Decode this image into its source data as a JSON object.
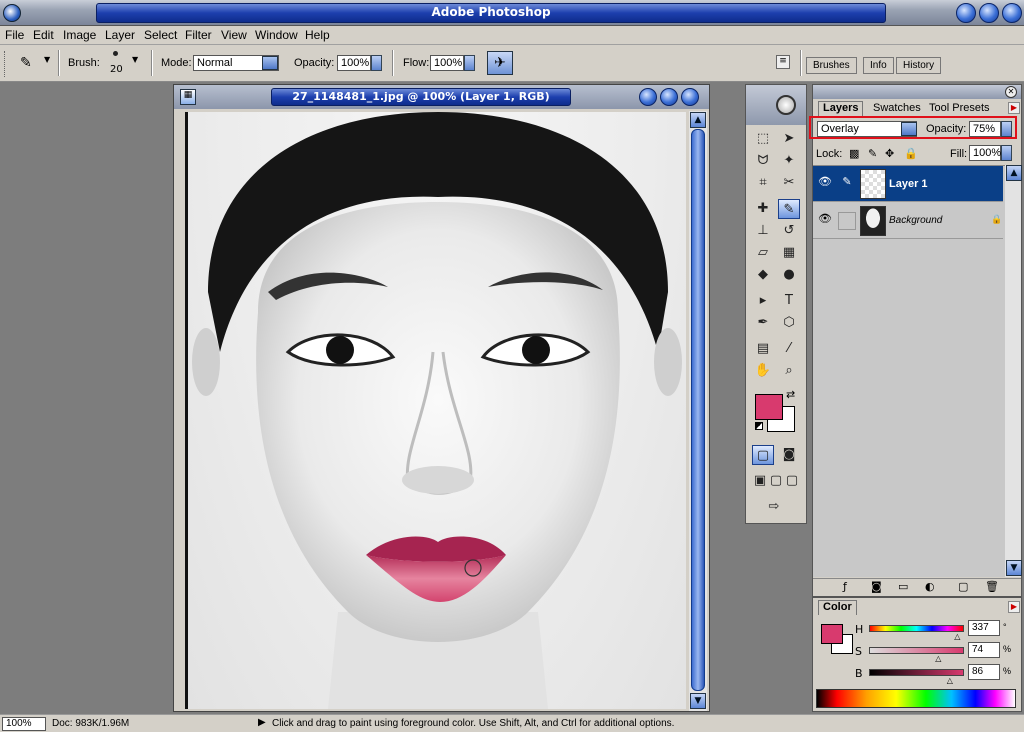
{
  "window": {
    "title": "Adobe Photoshop"
  },
  "menu": [
    "File",
    "Edit",
    "Image",
    "Layer",
    "Select",
    "Filter",
    "View",
    "Window",
    "Help"
  ],
  "options_bar": {
    "brush_label": "Brush:",
    "brush_size": "20",
    "mode_label": "Mode:",
    "mode_value": "Normal",
    "opacity_label": "Opacity:",
    "opacity_value": "100%",
    "flow_label": "Flow:",
    "flow_value": "100%"
  },
  "palette_well_tabs": [
    "Brushes",
    "Info",
    "History"
  ],
  "document": {
    "title": "27_1148481_1.jpg @ 100% (Layer 1, RGB)"
  },
  "layers_panel": {
    "tabs": [
      "Layers",
      "Swatches",
      "Tool Presets"
    ],
    "blend_mode": "Overlay",
    "opacity_label": "Opacity:",
    "opacity_value": "75%",
    "lock_label": "Lock:",
    "fill_label": "Fill:",
    "fill_value": "100%",
    "layers": [
      {
        "name": "Layer 1",
        "selected": true
      },
      {
        "name": "Background",
        "selected": false
      }
    ]
  },
  "color_panel": {
    "tab": "Color",
    "foreground_color": "#d83a6e",
    "background_color": "#ffffff",
    "channels": [
      {
        "label": "H",
        "value": "337",
        "unit": "°",
        "level": 0.94
      },
      {
        "label": "S",
        "value": "74",
        "unit": "%",
        "level": 0.74
      },
      {
        "label": "B",
        "value": "86",
        "unit": "%",
        "level": 0.86
      }
    ]
  },
  "status_bar": {
    "zoom": "100%",
    "doc_size": "Doc: 983K/1.96M",
    "hint": "Click and drag to paint using foreground color.  Use Shift, Alt, and Ctrl for additional options."
  },
  "colors": {
    "accent_blue": "#1d3fae",
    "selected_layer": "#0a3f87",
    "highlight_frame": "#e0101a"
  }
}
